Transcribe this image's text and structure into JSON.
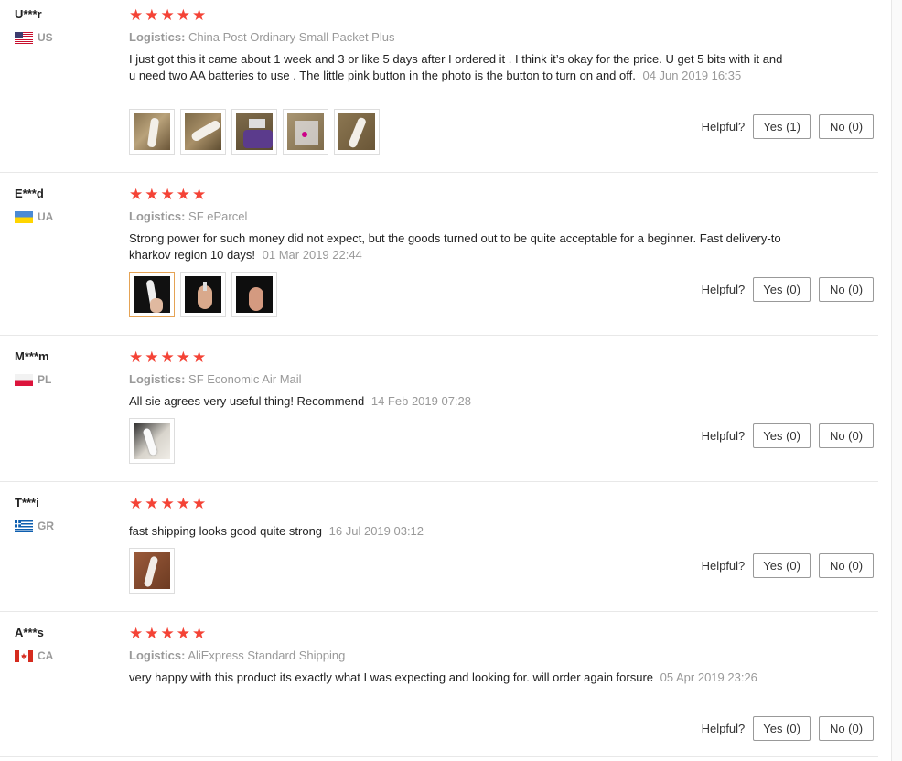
{
  "logistics_label": "Logistics:",
  "helpful_label": "Helpful?",
  "reviews": [
    {
      "user": "U***r",
      "country": "US",
      "stars": 5,
      "logistics": "China Post Ordinary Small Packet Plus",
      "text": "I just got this it came about 1 week and 3 or like 5 days after I ordered it . I think it’s okay for the price. U get 5 bits with it and u need two AA batteries to use . The little pink button in the photo is the button to turn on and off.",
      "date": "04 Jun 2019 16:35",
      "yes": "Yes (1)",
      "no": "No (0)"
    },
    {
      "user": "E***d",
      "country": "UA",
      "stars": 5,
      "logistics": "SF eParcel",
      "text": "Strong power for such money did not expect, but the goods turned out to be quite acceptable for a beginner. Fast delivery-to kharkov region 10 days!",
      "date": "01 Mar 2019 22:44",
      "yes": "Yes (0)",
      "no": "No (0)"
    },
    {
      "user": "M***m",
      "country": "PL",
      "stars": 5,
      "logistics": "SF Economic Air Mail",
      "text": "All sie agrees very useful thing! Recommend",
      "date": "14 Feb 2019 07:28",
      "yes": "Yes (0)",
      "no": "No (0)"
    },
    {
      "user": "T***i",
      "country": "GR",
      "stars": 5,
      "logistics": "",
      "text": "fast shipping looks good quite strong",
      "date": "16 Jul 2019 03:12",
      "yes": "Yes (0)",
      "no": "No (0)"
    },
    {
      "user": "A***s",
      "country": "CA",
      "stars": 5,
      "logistics": "AliExpress Standard Shipping",
      "text": "very happy with this product its exactly what I was expecting and looking for. will order again forsure",
      "date": "05 Apr 2019 23:26",
      "yes": "Yes (0)",
      "no": "No (0)"
    }
  ],
  "star_glyph": "★",
  "colors": {
    "star": "#f44336",
    "muted": "#999999",
    "selected_thumb_border": "#e5a355"
  }
}
